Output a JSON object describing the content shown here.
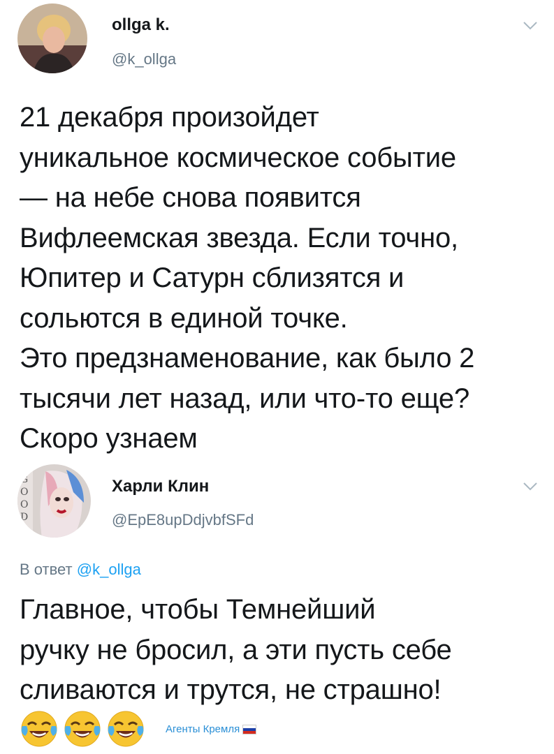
{
  "tweet": {
    "author_name": "ollga k.",
    "author_handle": "@k_ollga",
    "text": "21 декабря произойдет\nуникальное космическое событие\n— на небе снова появится\nВифлеемская звезда. Если точно,\nЮпитер и Сатурн сблизятся и\nсольются в единой точке.\nЭто предзнаменование, как было 2\nтысячи лет назад, или что-то еще?\nСкоро узнаем"
  },
  "reply": {
    "author_name": "Харли Клин",
    "author_handle": "@EpE8upDdjvbfSFd",
    "reply_to_prefix": "В ответ",
    "reply_to_handle": "@k_ollga",
    "text": "Главное, чтобы Темнейший\nручку не бросил, а эти пусть себе\nсливаются и трутся, не страшно!",
    "emojis": [
      "face-with-tears-of-joy",
      "face-with-tears-of-joy",
      "face-with-tears-of-joy"
    ]
  },
  "watermark": {
    "text": "Агенты Кремля",
    "flag": "russia-flag"
  },
  "colors": {
    "text": "#14171a",
    "secondary": "#657786",
    "link": "#1da1f2"
  }
}
